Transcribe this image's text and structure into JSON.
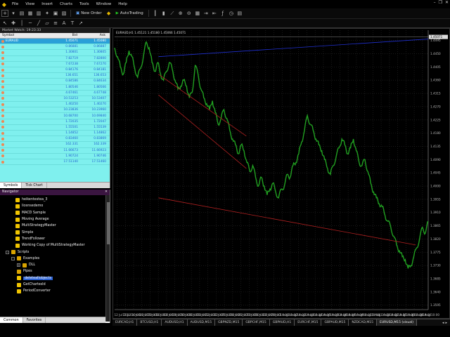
{
  "menubar": {
    "items": [
      "File",
      "View",
      "Insert",
      "Charts",
      "Tools",
      "Window",
      "Help"
    ]
  },
  "toolbar": {
    "new_order": "New Order",
    "auto_trading": "AutoTrading"
  },
  "market_watch": {
    "title": "Market Watch: 19:23:33",
    "col_symbol": "Symbol",
    "col_bid": "Bid",
    "col_ask": "Ask",
    "rows": [
      {
        "symbol": "EURAUD",
        "bid": "1.45071",
        "ask": "1.45080",
        "selected": true
      },
      {
        "symbol": "",
        "bid": "0.86881",
        "ask": "0.86887"
      },
      {
        "symbol": "",
        "bid": "1.30801",
        "ask": "1.30805"
      },
      {
        "symbol": "",
        "bid": "7.82719",
        "ask": "7.82800"
      },
      {
        "symbol": "",
        "bid": "7.67238",
        "ask": "7.67270"
      },
      {
        "symbol": "",
        "bid": "0.84176",
        "ask": "0.84181"
      },
      {
        "symbol": "",
        "bid": "136.651",
        "ask": "136.653"
      },
      {
        "symbol": "",
        "bid": "0.84586",
        "ask": "0.84634"
      },
      {
        "symbol": "",
        "bid": "1.80546",
        "ask": "1.80566"
      },
      {
        "symbol": "",
        "bid": "4.67461",
        "ask": "4.67748"
      },
      {
        "symbol": "",
        "bid": "10.53253",
        "ask": "10.53407"
      },
      {
        "symbol": "",
        "bid": "1.40250",
        "ask": "1.40270"
      },
      {
        "symbol": "",
        "bid": "10.23836",
        "ask": "10.23960"
      },
      {
        "symbol": "",
        "bid": "10.68700",
        "ask": "10.69840"
      },
      {
        "symbol": "",
        "bid": "1.72035",
        "ask": "1.72047"
      },
      {
        "symbol": "",
        "bid": "1.55501",
        "ask": "1.55539"
      },
      {
        "symbol": "",
        "bid": "1.14852",
        "ask": "1.14862"
      },
      {
        "symbol": "",
        "bid": "0.83460",
        "ask": "0.83869"
      },
      {
        "symbol": "",
        "bid": "162.331",
        "ask": "162.339"
      },
      {
        "symbol": "",
        "bid": "11.66673",
        "ask": "11.66923"
      },
      {
        "symbol": "",
        "bid": "1.90724",
        "ask": "1.90746"
      },
      {
        "symbol": "",
        "bid": "17.51140",
        "ask": "17.51460"
      }
    ],
    "tabs": [
      "Symbols",
      "Tick Chart"
    ]
  },
  "navigator": {
    "title": "Navigator",
    "items": [
      {
        "label": "heikentestea_3",
        "indent": 22,
        "type": "ea"
      },
      {
        "label": "licensedemo",
        "indent": 22,
        "type": "ea"
      },
      {
        "label": "MACD Sample",
        "indent": 22,
        "type": "ea"
      },
      {
        "label": "Moving Average",
        "indent": 22,
        "type": "ea"
      },
      {
        "label": "MultiStrategyMaster",
        "indent": 22,
        "type": "ea"
      },
      {
        "label": "Simple",
        "indent": 22,
        "type": "ea"
      },
      {
        "label": "TrendFollower",
        "indent": 22,
        "type": "ea"
      },
      {
        "label": "Working Copy of MultiStrategyMaster",
        "indent": 22,
        "type": "ea"
      },
      {
        "label": "Scripts",
        "indent": 8,
        "type": "folder",
        "toggle": "-"
      },
      {
        "label": "Examples",
        "indent": 16,
        "type": "folder",
        "toggle": "-"
      },
      {
        "label": "DLL",
        "indent": 24,
        "type": "folder",
        "toggle": "+"
      },
      {
        "label": "Pipes",
        "indent": 24,
        "type": "folder"
      },
      {
        "label": "deleteallobjects",
        "indent": 24,
        "type": "script",
        "highlight": true
      },
      {
        "label": "GetChartesId",
        "indent": 24,
        "type": "script"
      },
      {
        "label": "PeriodConverter",
        "indent": 24,
        "type": "script"
      }
    ],
    "tabs": [
      "Common",
      "Favorites"
    ]
  },
  "chart": {
    "info": "EURAUD,H1 1.45121 1.45180 1.45066 1.45071",
    "tabs": [
      {
        "label": "EURCAD,H1",
        "active": false
      },
      {
        "label": "BTCUSD,H1",
        "active": false
      },
      {
        "label": "AUDUSD,H1",
        "active": false
      },
      {
        "label": "AUDUSD,M15",
        "active": false
      },
      {
        "label": "GBPNZD,M15",
        "active": false
      },
      {
        "label": "GBPCHF,M15",
        "active": false
      },
      {
        "label": "GBPAUD,H1",
        "active": false
      },
      {
        "label": "EURCHF,M15",
        "active": false
      },
      {
        "label": "GBPAUD,M15",
        "active": false
      },
      {
        "label": "NZDCAD,M15",
        "active": false
      },
      {
        "label": "EURUSD,M15 (visual)",
        "active": true
      }
    ]
  },
  "chart_data": {
    "type": "line",
    "title": "EURAUD,H1",
    "xlabel": "",
    "ylabel": "",
    "x_ticks": [
      "12 Jul 2022",
      "13 Jul 10:00",
      "14 Jul 02:00",
      "14 Jul 18:00",
      "15 Jul 10:00",
      "18 Jul 02:00",
      "18 Jul 18:00",
      "19 Jul 10:00",
      "20 Jul 02:00",
      "20 Jul 18:00",
      "21 Jul 10:00",
      "22 Jul 02:00",
      "22 Jul 18:00",
      "25 Jul 10:00",
      "26 Jul 02:00",
      "26 Jul 18:00",
      "27 Jul 10:00",
      "28 Jul 02:00",
      "28 Jul 18:00",
      "29 Jul 10:00",
      "1 Aug 02:00",
      "1 Aug 18:00",
      "2 Aug 10:00",
      "3 Aug 02:00",
      "3 Aug 18:00",
      "4 Aug 10:00",
      "5 Aug 02:00",
      "5 Aug 18:00",
      "8 Aug 10:00",
      "9 Aug 02:00",
      "9 Aug 18:00",
      "10 Aug 10:00",
      "11 Aug 02:00",
      "11 Aug 18:00",
      "12 Aug 10:00",
      "15 Aug 02:00",
      "15 Aug 18:00",
      "16 Aug 10:00"
    ],
    "y_ticks": [
      "1.4495",
      "1.4450",
      "1.4405",
      "1.4360",
      "1.4315",
      "1.4270",
      "1.4225",
      "1.4180",
      "1.4135",
      "1.4090",
      "1.4045",
      "1.4000",
      "1.3955",
      "1.3910",
      "1.3865",
      "1.3820",
      "1.3775",
      "1.3730",
      "1.3685",
      "1.3640",
      "1.3595"
    ],
    "ylim": [
      1.358,
      1.453
    ],
    "current_price": "1.45071",
    "series_color": "#21a021",
    "values": [
      1.447,
      1.444,
      1.4405,
      1.438,
      1.442,
      1.446,
      1.444,
      1.44,
      1.437,
      1.44,
      1.444,
      1.449,
      1.447,
      1.442,
      1.439,
      1.442,
      1.438,
      1.436,
      1.439,
      1.442,
      1.44,
      1.436,
      1.433,
      1.434,
      1.436,
      1.434,
      1.43,
      1.432,
      1.441,
      1.438,
      1.433,
      1.43,
      1.428,
      1.426,
      1.429,
      1.425,
      1.421,
      1.423,
      1.426,
      1.423,
      1.419,
      1.416,
      1.414,
      1.411,
      1.414,
      1.412,
      1.408,
      1.405,
      1.407,
      1.403,
      1.4,
      1.403,
      1.4,
      1.397,
      1.399,
      1.401,
      1.398,
      1.396,
      1.399,
      1.4,
      1.404,
      1.403,
      1.407,
      1.408,
      1.411,
      1.415,
      1.419,
      1.424,
      1.421,
      1.419,
      1.416,
      1.414,
      1.412,
      1.409,
      1.406,
      1.404,
      1.407,
      1.41,
      1.413,
      1.416,
      1.414,
      1.411,
      1.413,
      1.416,
      1.412,
      1.408,
      1.407,
      1.409,
      1.405,
      1.401,
      1.398,
      1.396,
      1.394,
      1.393,
      1.39,
      1.388,
      1.386,
      1.383,
      1.38,
      1.378,
      1.376,
      1.375,
      1.372,
      1.373,
      1.376,
      1.379,
      1.382,
      1.386,
      1.384,
      1.388
    ],
    "lines": [
      {
        "name": "",
        "color": "#2030d0",
        "from": [
          0.14,
          1.444
        ],
        "to": [
          1.0,
          1.45
        ]
      },
      {
        "name": "",
        "color": "#b02020",
        "from": [
          0.14,
          1.438
        ],
        "to": [
          0.42,
          1.417
        ]
      },
      {
        "name": "",
        "color": "#b02020",
        "from": [
          0.14,
          1.431
        ],
        "to": [
          0.42,
          1.406
        ]
      },
      {
        "name": "",
        "color": "#b02020",
        "from": [
          0.14,
          1.396
        ],
        "to": [
          0.96,
          1.38
        ]
      }
    ]
  }
}
